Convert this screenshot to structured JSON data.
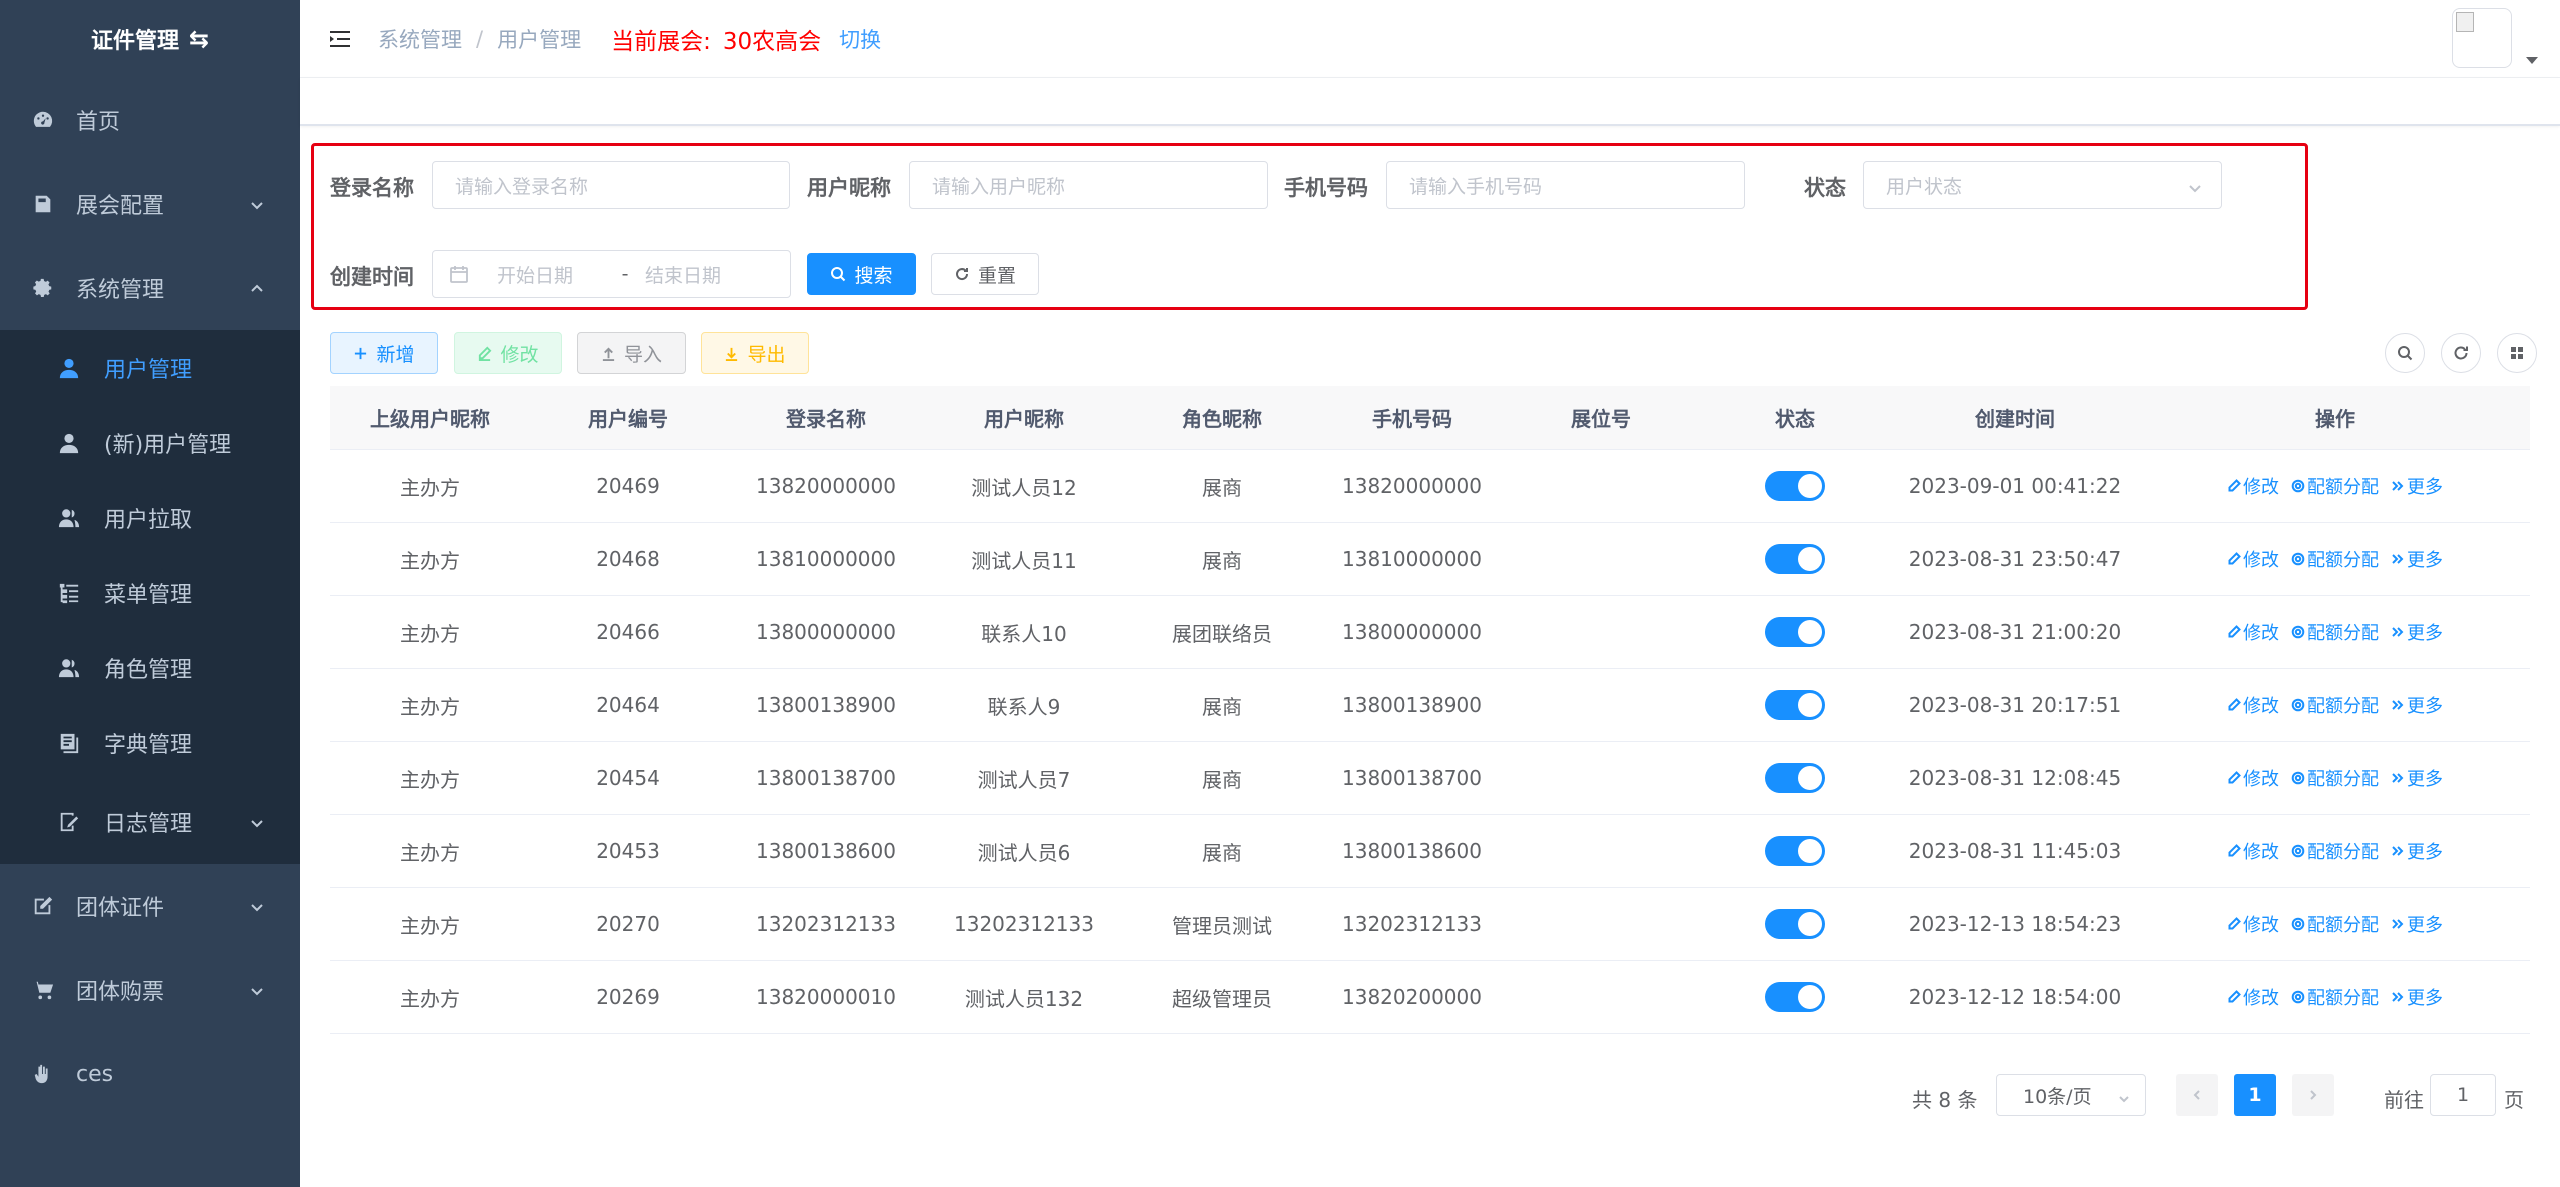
{
  "sidebar": {
    "title": "证件管理",
    "items": [
      {
        "label": "首页",
        "icon": "dashboard-icon"
      },
      {
        "label": "展会配置",
        "icon": "folder-icon"
      },
      {
        "label": "系统管理",
        "icon": "gear-icon"
      },
      {
        "label": "团体证件",
        "icon": "edit-icon"
      },
      {
        "label": "团体购票",
        "icon": "cart-icon"
      },
      {
        "label": "ces",
        "icon": "hand-icon"
      }
    ],
    "sub_items": [
      {
        "label": "用户管理",
        "icon": "user-icon",
        "active": true
      },
      {
        "label": "(新)用户管理",
        "icon": "user-icon"
      },
      {
        "label": "用户拉取",
        "icon": "peoples-icon"
      },
      {
        "label": "菜单管理",
        "icon": "tree-table-icon"
      },
      {
        "label": "角色管理",
        "icon": "peoples-icon"
      },
      {
        "label": "字典管理",
        "icon": "dict-icon"
      },
      {
        "label": "日志管理",
        "icon": "log-icon"
      }
    ]
  },
  "header": {
    "breadcrumb": [
      "系统管理",
      "用户管理"
    ],
    "expo_label": "当前展会:",
    "expo_name": "30农高会",
    "switch_label": "切换",
    "expo_color": "#ff0000"
  },
  "search": {
    "login_name_label": "登录名称",
    "login_name_placeholder": "请输入登录名称",
    "nickname_label": "用户昵称",
    "nickname_placeholder": "请输入用户昵称",
    "phone_label": "手机号码",
    "phone_placeholder": "请输入手机号码",
    "status_label": "状态",
    "status_placeholder": "用户状态",
    "created_label": "创建时间",
    "start_placeholder": "开始日期",
    "range_separator": "-",
    "end_placeholder": "结束日期",
    "search_button": "搜索",
    "reset_button": "重置"
  },
  "toolbar": {
    "add": "新增",
    "edit": "修改",
    "import": "导入",
    "export": "导出"
  },
  "table": {
    "columns": [
      "上级用户昵称",
      "用户编号",
      "登录名称",
      "用户昵称",
      "角色昵称",
      "手机号码",
      "展位号",
      "状态",
      "创建时间",
      "操作"
    ],
    "rows": [
      [
        "主办方",
        "20469",
        "13820000000",
        "测试人员12",
        "展商",
        "13820000000",
        "",
        "on",
        "2023-09-01 00:41:22"
      ],
      [
        "主办方",
        "20468",
        "13810000000",
        "测试人员11",
        "展商",
        "13810000000",
        "",
        "on",
        "2023-08-31 23:50:47"
      ],
      [
        "主办方",
        "20466",
        "13800000000",
        "联系人10",
        "展团联络员",
        "13800000000",
        "",
        "on",
        "2023-08-31 21:00:20"
      ],
      [
        "主办方",
        "20464",
        "13800138900",
        "联系人9",
        "展商",
        "13800138900",
        "",
        "on",
        "2023-08-31 20:17:51"
      ],
      [
        "主办方",
        "20454",
        "13800138700",
        "测试人员7",
        "展商",
        "13800138700",
        "",
        "on",
        "2023-08-31 12:08:45"
      ],
      [
        "主办方",
        "20453",
        "13800138600",
        "测试人员6",
        "展商",
        "13800138600",
        "",
        "on",
        "2023-08-31 11:45:03"
      ],
      [
        "主办方",
        "20270",
        "13202312133",
        "13202312133",
        "管理员测试",
        "13202312133",
        "",
        "on",
        "2023-12-13 18:54:23"
      ],
      [
        "主办方",
        "20269",
        "13820000010",
        "测试人员132",
        "超级管理员",
        "13820200000",
        "",
        "on",
        "2023-12-12 18:54:00"
      ]
    ],
    "row_actions": {
      "edit": "修改",
      "quota": "配额分配",
      "more": "更多"
    }
  },
  "pagination": {
    "total_text": "共 8 条",
    "page_size": "10条/页",
    "current_page": "1",
    "goto_label": "前往",
    "goto_value": "1",
    "page_suffix": "页"
  },
  "colors": {
    "sidebar_bg": "#304156",
    "submenu_bg": "#1f2d3d",
    "primary": "#1890ff",
    "highlight_border": "#e60012"
  }
}
